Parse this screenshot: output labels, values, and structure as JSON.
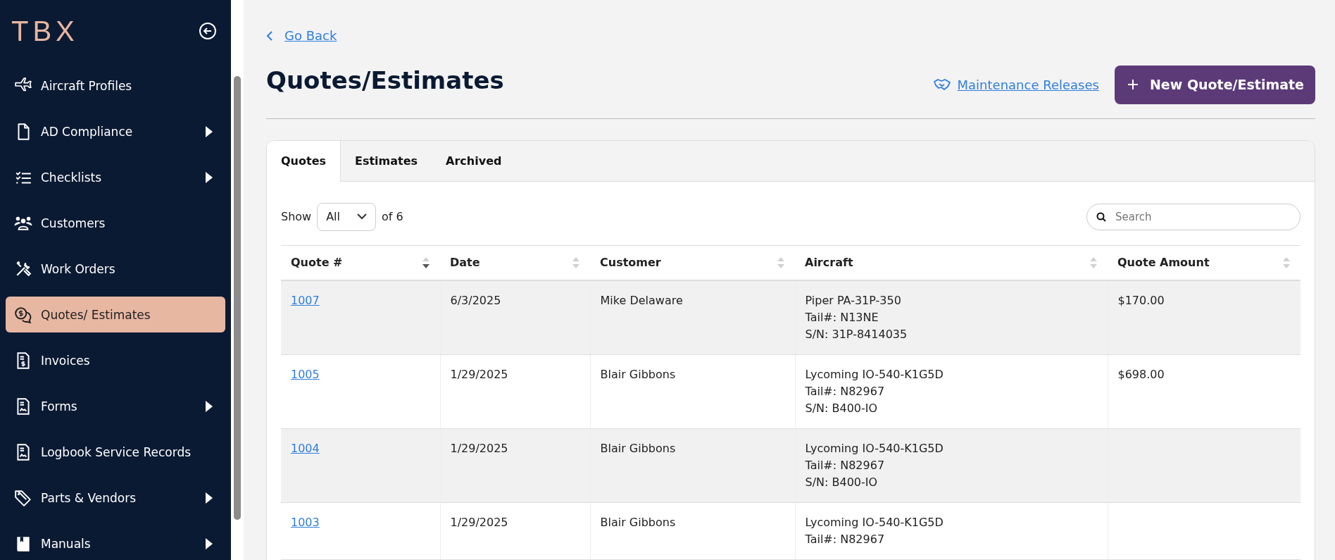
{
  "sidebar": {
    "logo": "TBX",
    "items": [
      {
        "label": "Aircraft Profiles",
        "has_submenu": false,
        "selected": false
      },
      {
        "label": "AD Compliance",
        "has_submenu": true,
        "selected": false
      },
      {
        "label": "Checklists",
        "has_submenu": true,
        "selected": false
      },
      {
        "label": "Customers",
        "has_submenu": false,
        "selected": false
      },
      {
        "label": "Work Orders",
        "has_submenu": false,
        "selected": false
      },
      {
        "label": "Quotes/ Estimates",
        "has_submenu": false,
        "selected": true
      },
      {
        "label": "Invoices",
        "has_submenu": false,
        "selected": false
      },
      {
        "label": "Forms",
        "has_submenu": true,
        "selected": false
      },
      {
        "label": "Logbook Service Records",
        "has_submenu": false,
        "selected": false
      },
      {
        "label": "Parts & Vendors",
        "has_submenu": true,
        "selected": false
      },
      {
        "label": "Manuals",
        "has_submenu": true,
        "selected": false
      }
    ]
  },
  "back_link": "Go Back",
  "page_title": "Quotes/Estimates",
  "maintenance_link": "Maintenance Releases",
  "new_button": "New Quote/Estimate",
  "tabs": [
    {
      "label": "Quotes",
      "selected": true
    },
    {
      "label": "Estimates",
      "selected": false
    },
    {
      "label": "Archived",
      "selected": false
    }
  ],
  "show": {
    "label": "Show",
    "value": "All",
    "suffix": "of 6"
  },
  "search": {
    "placeholder": "Search"
  },
  "table": {
    "columns": [
      {
        "label": "Quote #",
        "sorted": true
      },
      {
        "label": "Date",
        "sorted": false
      },
      {
        "label": "Customer",
        "sorted": false
      },
      {
        "label": "Aircraft",
        "sorted": false
      },
      {
        "label": "Quote Amount",
        "sorted": false
      }
    ],
    "rows": [
      {
        "quote": "1007",
        "date": "6/3/2025",
        "customer": "Mike Delaware",
        "aircraft": [
          "Piper PA-31P-350",
          "Tail#: N13NE",
          "S/N: 31P-8414035"
        ],
        "amount": "$170.00"
      },
      {
        "quote": "1005",
        "date": "1/29/2025",
        "customer": "Blair Gibbons",
        "aircraft": [
          "Lycoming IO-540-K1G5D",
          "Tail#: N82967",
          "S/N: B400-IO"
        ],
        "amount": "$698.00"
      },
      {
        "quote": "1004",
        "date": "1/29/2025",
        "customer": "Blair Gibbons",
        "aircraft": [
          "Lycoming IO-540-K1G5D",
          "Tail#: N82967",
          "S/N: B400-IO"
        ]
      },
      {
        "quote": "1003",
        "date": "1/29/2025",
        "customer": "Blair Gibbons",
        "aircraft": [
          "Lycoming IO-540-K1G5D",
          "Tail#: N82967"
        ]
      }
    ]
  }
}
